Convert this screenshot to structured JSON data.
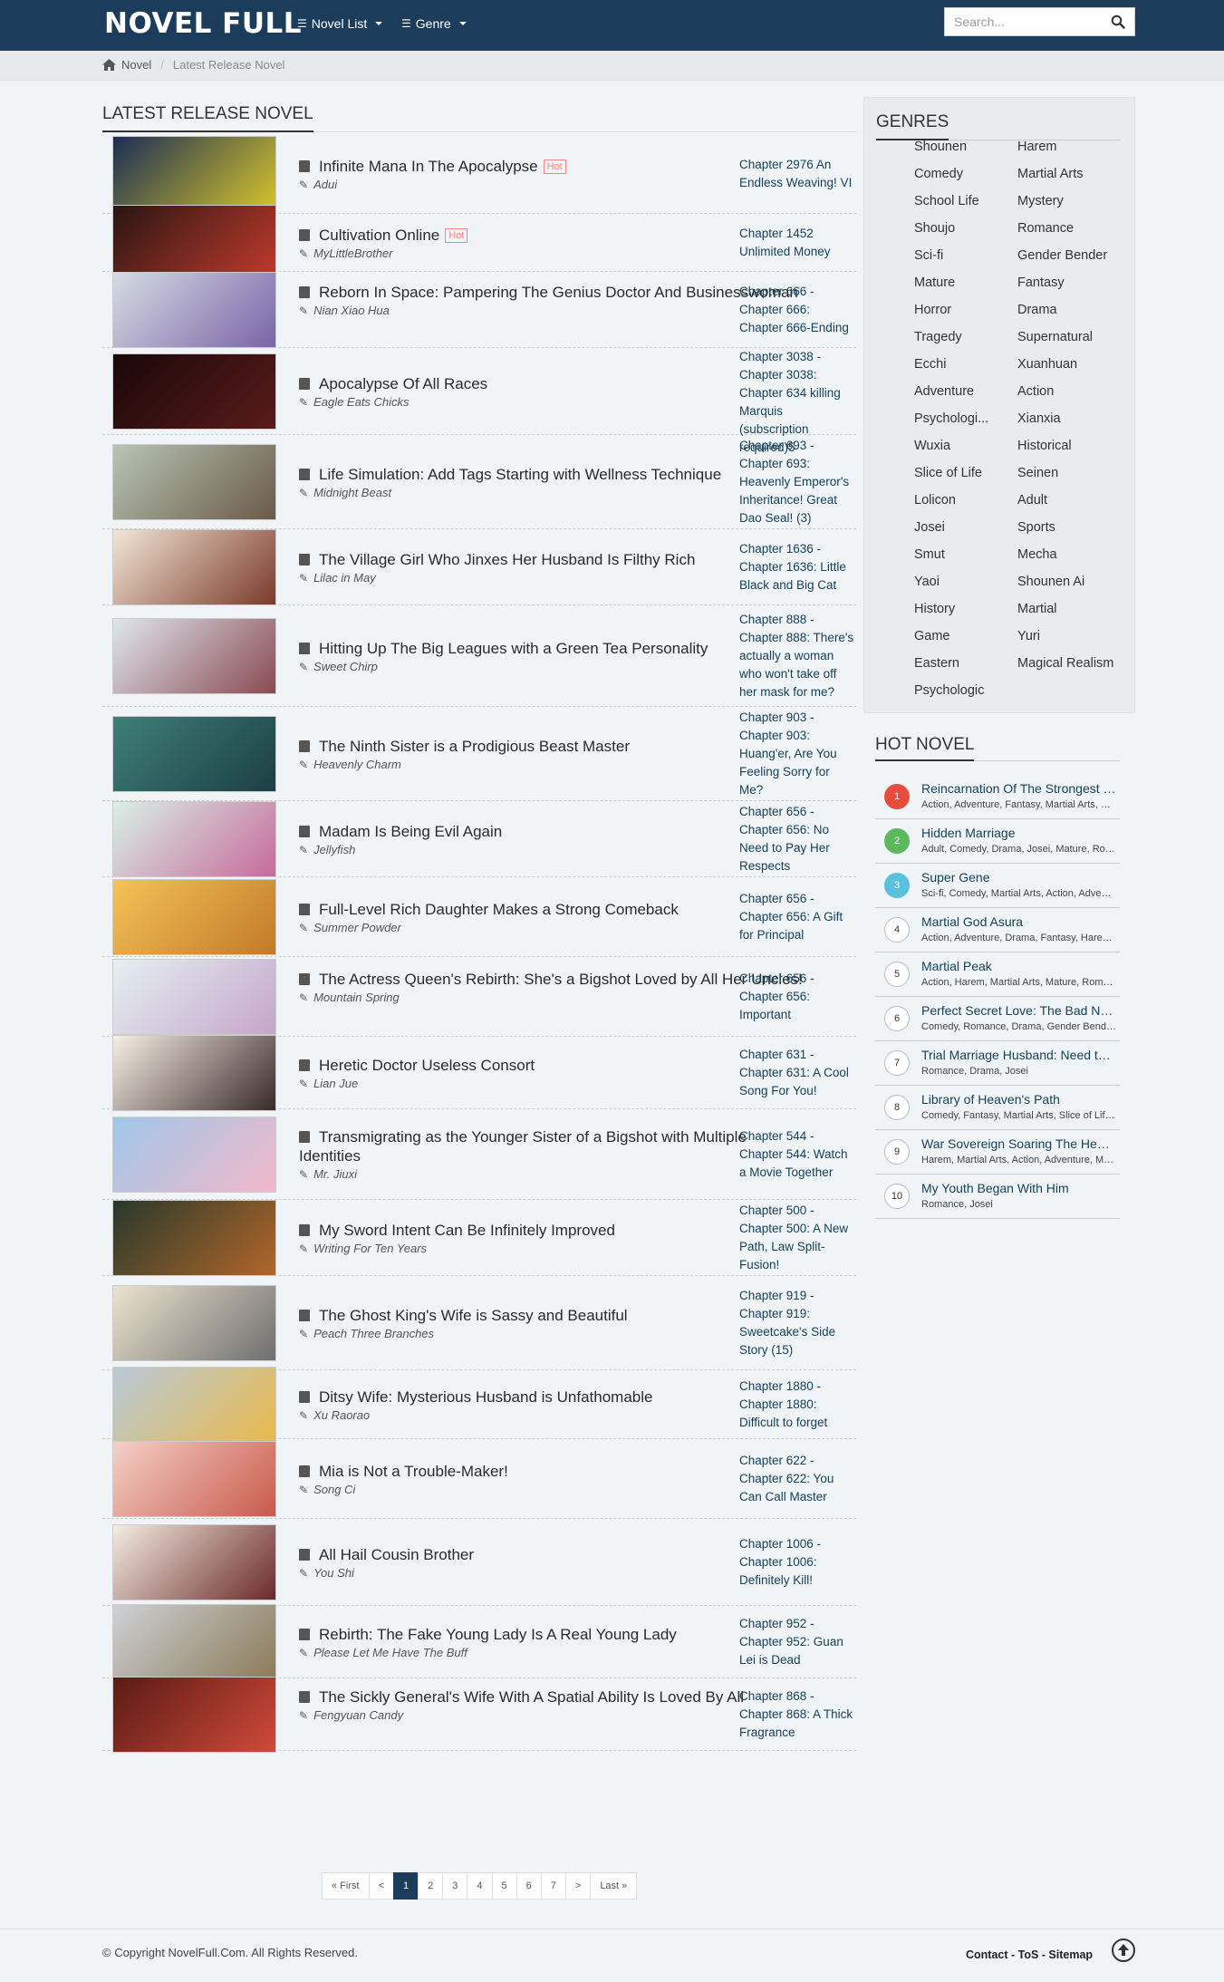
{
  "brand": "NOVEL FULL",
  "nav": {
    "novel_list": "Novel List",
    "genre": "Genre"
  },
  "search": {
    "placeholder": "Search..."
  },
  "breadcrumb": {
    "home": "Novel",
    "current": "Latest Release Novel"
  },
  "main": {
    "title": "LATEST RELEASE NOVEL",
    "hot_badge": "Hot"
  },
  "novels": [
    {
      "title": "Infinite Mana In The Apocalypse",
      "author": "Adui",
      "chapter": "Chapter 2976 An Endless Weaving! VI",
      "hot": true
    },
    {
      "title": "Cultivation Online",
      "author": "MyLittleBrother",
      "chapter": "Chapter 1452 Unlimited Money",
      "hot": true
    },
    {
      "title": "Reborn In Space: Pampering The Genius Doctor And Businesswoman",
      "author": "Nian Xiao Hua",
      "chapter": "Chapter 666 - Chapter 666: Chapter 666-Ending",
      "hot": false
    },
    {
      "title": "Apocalypse Of All Races",
      "author": "Eagle Eats Chicks",
      "chapter": "Chapter 3038 - Chapter 3038: Chapter 634 killing Marquis (subscription required)5",
      "hot": false
    },
    {
      "title": "Life Simulation: Add Tags Starting with Wellness Technique",
      "author": "Midnight Beast",
      "chapter": "Chapter 693 - Chapter 693: Heavenly Emperor's Inheritance! Great Dao Seal! (3)",
      "hot": false
    },
    {
      "title": "The Village Girl Who Jinxes Her Husband Is Filthy Rich",
      "author": "Lilac in May",
      "chapter": "Chapter 1636 - Chapter 1636: Little Black and Big Cat",
      "hot": false
    },
    {
      "title": "Hitting Up The Big Leagues with a Green Tea Personality",
      "author": "Sweet Chirp",
      "chapter": "Chapter 888 - Chapter 888: There's actually a woman who won't take off her mask for me?",
      "hot": false
    },
    {
      "title": "The Ninth Sister is a Prodigious Beast Master",
      "author": "Heavenly Charm",
      "chapter": "Chapter 903 - Chapter 903: Huang'er, Are You Feeling Sorry for Me?",
      "hot": false
    },
    {
      "title": "Madam Is Being Evil Again",
      "author": "Jellyfish",
      "chapter": "Chapter 656 - Chapter 656: No Need to Pay Her Respects",
      "hot": false
    },
    {
      "title": "Full-Level Rich Daughter Makes a Strong Comeback",
      "author": "Summer Powder",
      "chapter": "Chapter 656 - Chapter 656: A Gift for Principal",
      "hot": false
    },
    {
      "title": "The Actress Queen's Rebirth: She's a Bigshot Loved by All Her Uncles!",
      "author": "Mountain Spring",
      "chapter": "Chapter 656 - Chapter 656: Important",
      "hot": false
    },
    {
      "title": "Heretic Doctor Useless Consort",
      "author": "Lian Jue",
      "chapter": "Chapter 631 - Chapter 631: A Cool Song For You!",
      "hot": false
    },
    {
      "title": "Transmigrating as the Younger Sister of a Bigshot with Multiple Identities",
      "author": "Mr. Jiuxi",
      "chapter": "Chapter 544 - Chapter 544: Watch a Movie Together",
      "hot": false
    },
    {
      "title": "My Sword Intent Can Be Infinitely Improved",
      "author": "Writing For Ten Years",
      "chapter": "Chapter 500 - Chapter 500: A New Path, Law Split-Fusion!",
      "hot": false
    },
    {
      "title": "The Ghost King's Wife is Sassy and Beautiful",
      "author": "Peach Three Branches",
      "chapter": "Chapter 919 - Chapter 919: Sweetcake's Side Story (15)",
      "hot": false
    },
    {
      "title": "Ditsy Wife: Mysterious Husband is Unfathomable",
      "author": "Xu Raorao",
      "chapter": "Chapter 1880 - Chapter 1880: Difficult to forget",
      "hot": false
    },
    {
      "title": "Mia is Not a Trouble-Maker!",
      "author": "Song Ci",
      "chapter": "Chapter 622 - Chapter 622: You Can Call Master",
      "hot": false
    },
    {
      "title": "All Hail Cousin Brother",
      "author": "You Shi",
      "chapter": "Chapter 1006 - Chapter 1006: Definitely Kill!",
      "hot": false
    },
    {
      "title": "Rebirth: The Fake Young Lady Is A Real Young Lady",
      "author": "Please Let Me Have The Buff",
      "chapter": "Chapter 952 - Chapter 952: Guan Lei is Dead",
      "hot": false
    },
    {
      "title": "The Sickly General's Wife With A Spatial Ability Is Loved By All",
      "author": "Fengyuan Candy",
      "chapter": "Chapter 868 - Chapter 868: A Thick Fragrance",
      "hot": false
    }
  ],
  "genres": {
    "title": "GENRES",
    "left": [
      "Shounen",
      "Comedy",
      "School Life",
      "Shoujo",
      "Sci-fi",
      "Mature",
      "Horror",
      "Tragedy",
      "Ecchi",
      "Adventure",
      "Psychologi...",
      "Wuxia",
      "Slice of Life",
      "Lolicon",
      "Josei",
      "Smut",
      "Yaoi",
      "History",
      "Game",
      "Eastern",
      "Psychologic"
    ],
    "right": [
      "Harem",
      "Martial Arts",
      "Mystery",
      "Romance",
      "Gender Bender",
      "Fantasy",
      "Drama",
      "Supernatural",
      "Xuanhuan",
      "Action",
      "Xianxia",
      "Historical",
      "Seinen",
      "Adult",
      "Sports",
      "Mecha",
      "Shounen Ai",
      "Martial",
      "Yuri",
      "Magical Realism"
    ]
  },
  "hot_novels": {
    "title": "HOT NOVEL",
    "items": [
      {
        "rank": "1",
        "name": "Reincarnation Of The Strongest Sword God",
        "genres": "Action, Adventure, Fantasy, Martial Arts, Xuanhuan"
      },
      {
        "rank": "2",
        "name": "Hidden Marriage",
        "genres": "Adult, Comedy, Drama, Josei, Mature, Romance"
      },
      {
        "rank": "3",
        "name": "Super Gene",
        "genres": "Sci-fi, Comedy, Martial Arts, Action, Adventure"
      },
      {
        "rank": "4",
        "name": "Martial God Asura",
        "genres": "Action, Adventure, Drama, Fantasy, Harem, Martial Arts"
      },
      {
        "rank": "5",
        "name": "Martial Peak",
        "genres": "Action, Harem, Martial Arts, Mature, Romance"
      },
      {
        "rank": "6",
        "name": "Perfect Secret Love: The Bad New Wife is a Little Sweet",
        "genres": "Comedy, Romance, Drama, Gender Bender, Josei"
      },
      {
        "rank": "7",
        "name": "Trial Marriage Husband: Need to Work Hard",
        "genres": "Romance, Drama, Josei"
      },
      {
        "rank": "8",
        "name": "Library of Heaven's Path",
        "genres": "Comedy, Fantasy, Martial Arts, Slice of Life, Xuanhuan"
      },
      {
        "rank": "9",
        "name": "War Sovereign Soaring The Heavens",
        "genres": "Harem, Martial Arts, Action, Adventure, Mature"
      },
      {
        "rank": "10",
        "name": "My Youth Began With Him",
        "genres": "Romance, Josei"
      }
    ]
  },
  "pagination": [
    "« First",
    "<",
    "1",
    "2",
    "3",
    "4",
    "5",
    "6",
    "7",
    ">",
    "Last »"
  ],
  "footer": {
    "copyright": "© Copyright NovelFull.Com. All Rights Reserved.",
    "links": "Contact - ToS - Sitemap"
  },
  "colors": {
    "header": "#1c3c5c",
    "link": "#14425d",
    "hot_badge": "#fd8383",
    "rank1": "#e74c3c",
    "rank2": "#5cb85c",
    "rank3": "#5bc0de"
  }
}
